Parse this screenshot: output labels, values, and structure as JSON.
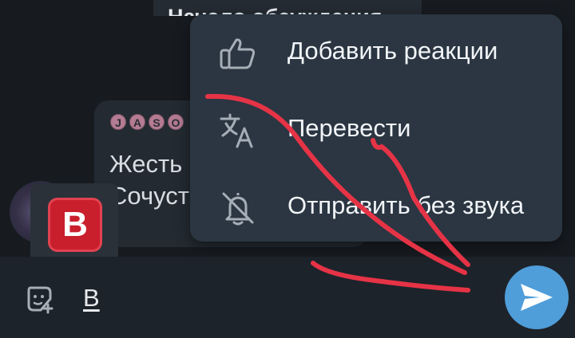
{
  "chat": {
    "service_message": "Начало обсуждения",
    "sender_tags": [
      "J",
      "A",
      "S",
      "O"
    ],
    "message_lines": [
      "Жесть",
      "Сочуст"
    ],
    "sticker_label": "B"
  },
  "context_menu": {
    "items": [
      {
        "label": "Добавить реакции",
        "icon": "thumbs-up-icon"
      },
      {
        "label": "Перевести",
        "icon": "translate-icon"
      },
      {
        "label": "Отправить без звука",
        "icon": "bell-off-icon"
      }
    ]
  },
  "composer": {
    "input_value": "B",
    "send_icon": "paper-plane-icon",
    "sticker_icon": "sticker-icon"
  },
  "colors": {
    "menu_bg": "#2b3642",
    "send_button": "#4f9dd9",
    "annotation": "#e63346",
    "b_emoji": "#c91f2d"
  }
}
